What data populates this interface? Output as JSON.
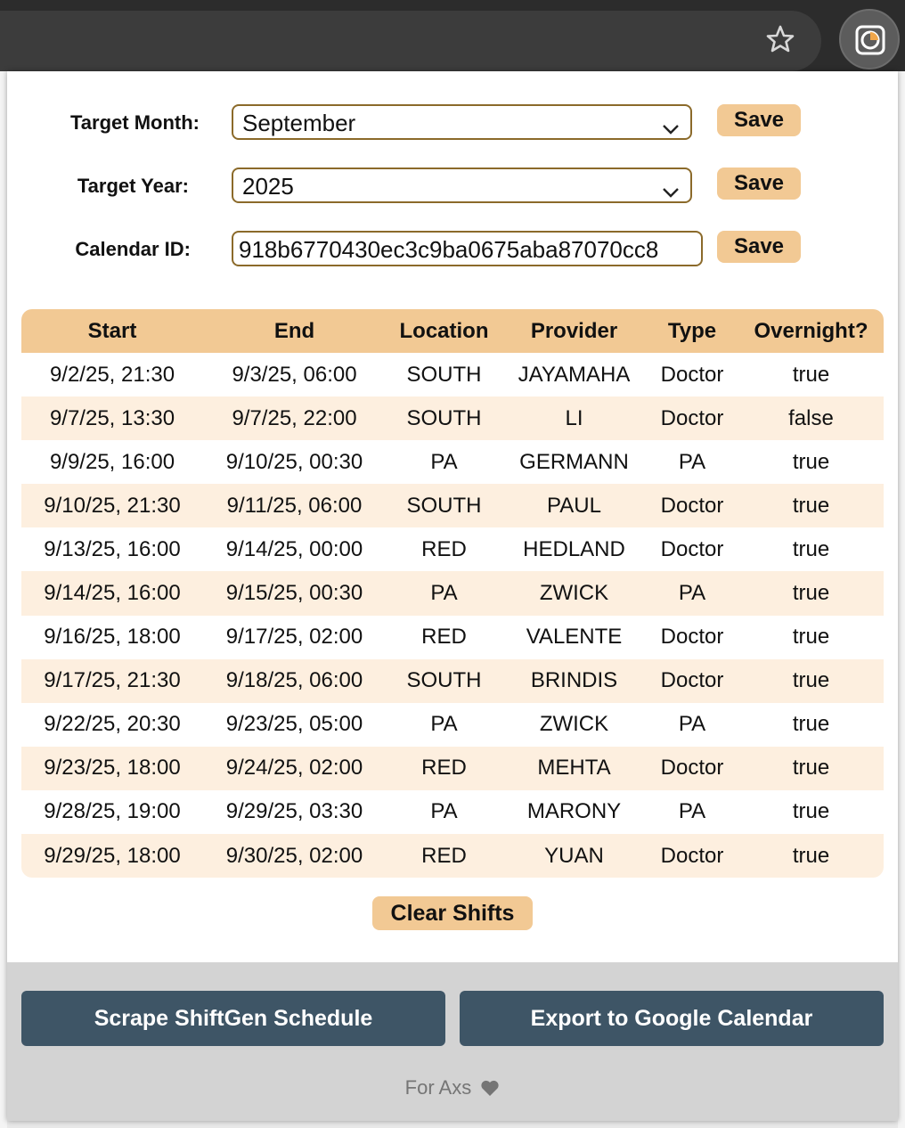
{
  "form": {
    "target_month_label": "Target Month:",
    "target_month_value": "September",
    "target_year_label": "Target Year:",
    "target_year_value": "2025",
    "calendar_id_label": "Calendar ID:",
    "calendar_id_value": "918b6770430ec3c9ba0675aba87070cc8",
    "save_label": "Save"
  },
  "table": {
    "columns": [
      "Start",
      "End",
      "Location",
      "Provider",
      "Type",
      "Overnight?"
    ],
    "rows": [
      [
        "9/2/25, 21:30",
        "9/3/25, 06:00",
        "SOUTH",
        "JAYAMAHA",
        "Doctor",
        "true"
      ],
      [
        "9/7/25, 13:30",
        "9/7/25, 22:00",
        "SOUTH",
        "LI",
        "Doctor",
        "false"
      ],
      [
        "9/9/25, 16:00",
        "9/10/25, 00:30",
        "PA",
        "GERMANN",
        "PA",
        "true"
      ],
      [
        "9/10/25, 21:30",
        "9/11/25, 06:00",
        "SOUTH",
        "PAUL",
        "Doctor",
        "true"
      ],
      [
        "9/13/25, 16:00",
        "9/14/25, 00:00",
        "RED",
        "HEDLAND",
        "Doctor",
        "true"
      ],
      [
        "9/14/25, 16:00",
        "9/15/25, 00:30",
        "PA",
        "ZWICK",
        "PA",
        "true"
      ],
      [
        "9/16/25, 18:00",
        "9/17/25, 02:00",
        "RED",
        "VALENTE",
        "Doctor",
        "true"
      ],
      [
        "9/17/25, 21:30",
        "9/18/25, 06:00",
        "SOUTH",
        "BRINDIS",
        "Doctor",
        "true"
      ],
      [
        "9/22/25, 20:30",
        "9/23/25, 05:00",
        "PA",
        "ZWICK",
        "PA",
        "true"
      ],
      [
        "9/23/25, 18:00",
        "9/24/25, 02:00",
        "RED",
        "MEHTA",
        "Doctor",
        "true"
      ],
      [
        "9/28/25, 19:00",
        "9/29/25, 03:30",
        "PA",
        "MARONY",
        "PA",
        "true"
      ],
      [
        "9/29/25, 18:00",
        "9/30/25, 02:00",
        "RED",
        "YUAN",
        "Doctor",
        "true"
      ]
    ]
  },
  "actions": {
    "clear_label": "Clear Shifts",
    "scrape_label": "Scrape ShiftGen Schedule",
    "export_label": "Export to Google Calendar"
  },
  "footer": {
    "credit": "For Axs",
    "credit_icon": "heart-icon"
  },
  "colors": {
    "accent": "#f2c994",
    "row_alt": "#fdefdf",
    "button_dark": "#3e5566",
    "footer_bg": "#d3d3d3"
  },
  "browser": {
    "bookmark_icon": "star-icon",
    "extension_icon": "extension-pie-icon"
  }
}
